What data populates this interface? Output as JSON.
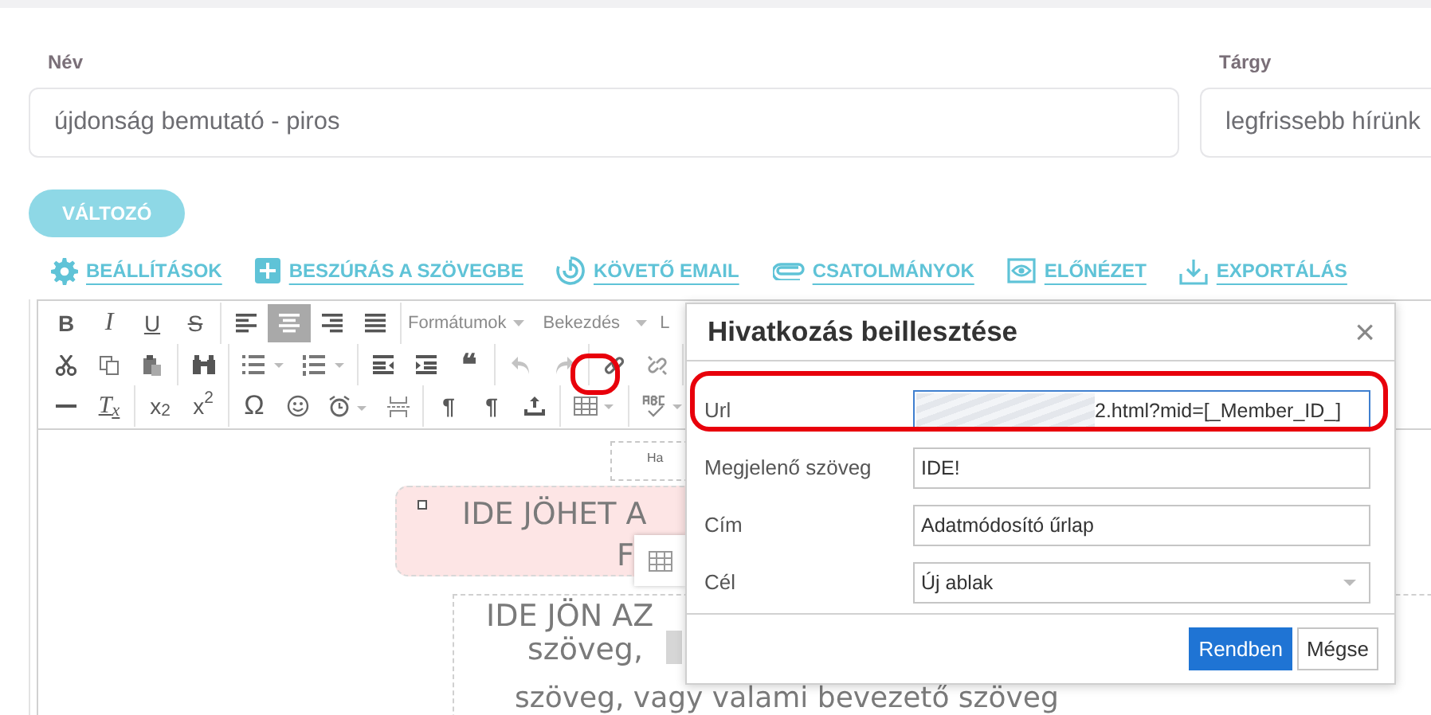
{
  "fields": [
    {
      "label": "Név",
      "value": "újdonság bemutató - piros"
    },
    {
      "label": "Tárgy",
      "value": "legfrissebb hírünk"
    }
  ],
  "variable_button": "VÁLTOZÓ",
  "links": [
    {
      "label": "BEÁLLÍTÁSOK"
    },
    {
      "label": "BESZÚRÁS A SZÖVEGBE"
    },
    {
      "label": "KÖVETŐ EMAIL"
    },
    {
      "label": "CSATOLMÁNYOK"
    },
    {
      "label": "ELŐNÉZET"
    },
    {
      "label": "EXPORTÁLÁS"
    }
  ],
  "editor": {
    "format_glyphs": [
      "B",
      "I",
      "U",
      "S"
    ],
    "align": [
      {
        "selected": false
      },
      {
        "selected": true
      },
      {
        "selected": false
      },
      {
        "selected": false
      }
    ],
    "dropdowns": [
      "Formátumok",
      "Bekezdés"
    ],
    "cut_label": "L",
    "quote_glyph": "❝",
    "history": [
      {
        "disabled": true
      },
      {
        "disabled": true
      }
    ],
    "script_glyphs": [
      "T$_{x}$",
      "x$_{2}$",
      "x$^{2}$"
    ],
    "symbol_glyphs": [
      "Ω",
      "¶",
      "¶"
    ],
    "content": {
      "corner_text": "Ha",
      "heading_lines": [
        "IDE JÖHET A",
        "F"
      ],
      "body_lines": [
        "IDE JÖN AZ",
        "szöveg,",
        "szöveg, vagy valami bevezető szöveg"
      ]
    }
  },
  "dialog": {
    "title": "Hivatkozás beillesztése",
    "close": "×",
    "fields": [
      {
        "kind": "text",
        "label": "Url",
        "value": "2.html?mid=[_Member_ID_]",
        "focused": true,
        "redacted": true
      },
      {
        "kind": "text",
        "label": "Megjelenő szöveg",
        "value": "IDE!",
        "focused": false
      },
      {
        "kind": "text",
        "label": "Cím",
        "value": "Adatmódosító űrlap",
        "focused": false
      },
      {
        "kind": "select",
        "label": "Cél",
        "value": "Új ablak",
        "focused": false
      }
    ],
    "buttons": [
      {
        "label": "Rendben",
        "primary": true
      },
      {
        "label": "Mégse",
        "primary": false
      }
    ]
  }
}
